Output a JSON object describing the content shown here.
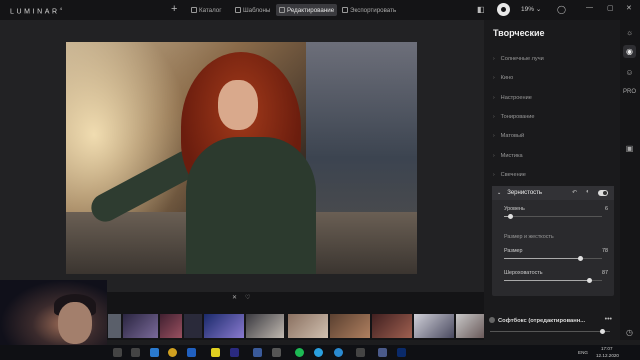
{
  "app": {
    "name": "LUMINAR",
    "version": "4"
  },
  "topbar": {
    "tabs": [
      {
        "label": "Каталог"
      },
      {
        "label": "Шаблоны"
      },
      {
        "label": "Редактирование"
      },
      {
        "label": "Экспортировать"
      }
    ],
    "active_tab": "Редактирование",
    "zoom": "19%",
    "zoom_dropdown": "⌄"
  },
  "panel": {
    "title": "Творческие",
    "tools": [
      {
        "label": "Солнечные лучи"
      },
      {
        "label": "Кино"
      },
      {
        "label": "Настроение"
      },
      {
        "label": "Тонирование"
      },
      {
        "label": "Матовый"
      },
      {
        "label": "Мистика"
      },
      {
        "label": "Свечение"
      }
    ],
    "grain": {
      "label": "Зернистость",
      "amount_label": "Уровень",
      "amount_value": "6",
      "amount_level": 0.06,
      "group_label": "Размер и жесткость",
      "size_label": "Размер",
      "size_value": "78",
      "size_level": 0.78,
      "roughness_label": "Шероховатость",
      "roughness_value": "87",
      "roughness_level": 0.87
    }
  },
  "preset": {
    "name": "Софтбокс (отредактированн...",
    "dots": "•••",
    "level": 0.92
  },
  "filmstrip": {
    "close": "✕",
    "heart": "♡"
  },
  "rightbar": {
    "pro_label": "PRO"
  },
  "taskbar": {
    "language": "ENG",
    "time": "17:07",
    "date": "12.12.2020"
  },
  "colors": {
    "accent": "#e0e0e0",
    "panel_bg": "#1a1a1c",
    "active_tab_bg": "#3a3a3e"
  }
}
